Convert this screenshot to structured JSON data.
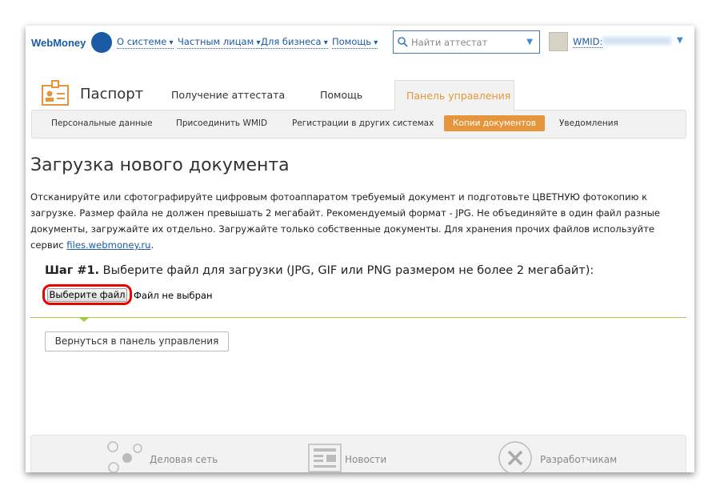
{
  "header": {
    "logo": "WebMoney",
    "nav": [
      "О системе",
      "Частным лицам",
      "Для бизнеса",
      "Помощь"
    ],
    "search_placeholder": "Найти аттестат",
    "wmid_label": "WMID:"
  },
  "tabs": {
    "title": "Паспорт",
    "items": [
      "Получение аттестата",
      "Помощь",
      "Панель управления"
    ]
  },
  "subnav": [
    "Персональные данные",
    "Присоединить WMID",
    "Регистрации в других системах",
    "Копии документов",
    "Уведомления"
  ],
  "main": {
    "heading": "Загрузка нового документа",
    "description": "Отсканируйте или сфотографируйте цифровым фотоаппаратом требуемый документ и подготовьте ЦВЕТНУЮ фотокопию к загрузке. Размер файла не должен превышать 2 мегабайт. Рекомендуемый формат - JPG. Не объединяйте в один файл разные документы, загружайте их отдельно. Загружайте только собственные документы. Для хранения прочих файлов используйте сервис",
    "link": "files.webmoney.ru",
    "link_suffix": ".",
    "step_label": "Шаг #1.",
    "step_text": " Выберите файл для загрузки (JPG, GIF или PNG размером не более 2 мегабайт):",
    "file_button": "Выберите файл",
    "file_status": "Файл не выбран",
    "back_button": "Вернуться в панель управления"
  },
  "footer": [
    "Деловая сеть",
    "Новости",
    "Разработчикам"
  ],
  "colors": {
    "accent": "#e5953b",
    "brand": "#1b5aa5",
    "highlight": "#e00000"
  }
}
